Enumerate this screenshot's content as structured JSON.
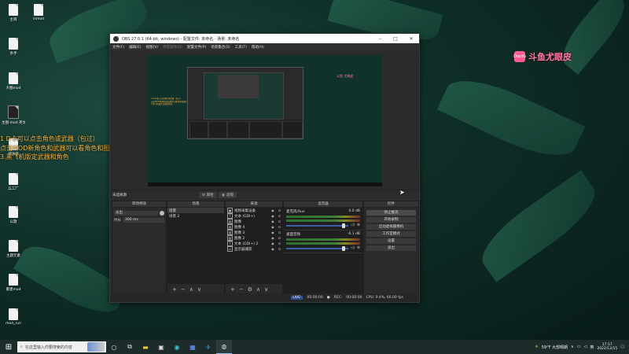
{
  "desktop_icons": [
    {
      "label": "主目",
      "dark": false
    },
    {
      "label": "inmod",
      "dark": false
    },
    {
      "label": "杀手",
      "dark": false
    },
    {
      "label": "大图mod",
      "dark": false
    },
    {
      "label": "主图-mod 英文",
      "dark": true
    },
    {
      "label": "播放器",
      "dark": false
    },
    {
      "label": "兵工厂",
      "dark": false
    },
    {
      "label": "以歌",
      "dark": false
    },
    {
      "label": "主题元素",
      "dark": false
    },
    {
      "label": "重建mod",
      "dark": false
    },
    {
      "label": "mod_run",
      "dark": false
    }
  ],
  "overlay_lines": [
    "1 D卡可以点击角色或武器（包过）",
    "点击MOD新角色和武器可以看角色和图片",
    "3.黑飞机版定武器和角色"
  ],
  "watermark": {
    "logo": "DouYu",
    "text": "斗鱼尤眼皮",
    "small": "斗鱼 尤眼皮"
  },
  "obs": {
    "title": "OBS 27.0.1 (64-bit, windows) - 配置文件: 未命名 - 场景: 未命名",
    "menu": [
      "文件(F)",
      "编辑(E)",
      "视图(V)",
      "停靠部件(D)",
      "配置文件(P)",
      "场景集合(S)",
      "工具(T)",
      "帮助(H)"
    ],
    "menu_dim": [
      false,
      false,
      false,
      true,
      false,
      false,
      false,
      false
    ],
    "no_source": "未选择源",
    "props_btn": "属性",
    "filters_btn": "滤镜",
    "docks": {
      "scene_transitions": "转场特效",
      "scenes": "场景",
      "sources": "来源",
      "mixer": "混音器",
      "controls": "控件"
    },
    "transition": {
      "name": "淡出",
      "duration_label": "时长",
      "duration": "300 ms"
    },
    "scenes": [
      "场景",
      "场景 2"
    ],
    "sources": [
      {
        "icon": "▣",
        "name": "视频采集设备"
      },
      {
        "icon": "T",
        "name": "文本 (GDI+)"
      },
      {
        "icon": "▨",
        "name": "图像"
      },
      {
        "icon": "▨",
        "name": "图像 4"
      },
      {
        "icon": "▨",
        "name": "图像 3"
      },
      {
        "icon": "▨",
        "name": "图像 2"
      },
      {
        "icon": "T",
        "name": "文本 (GDI+) 2"
      },
      {
        "icon": "▭",
        "name": "显示器捕获"
      }
    ],
    "mixer": [
      {
        "name": "麦克风/Aux",
        "db": "0.0 dB"
      },
      {
        "name": "桌面音频",
        "db": "-6.1 dB"
      }
    ],
    "controls": [
      "停止推流",
      "开始录制",
      "启动虚拟摄像机",
      "工作室模式",
      "设置",
      "退出"
    ],
    "status": {
      "live_label": "LIVE:",
      "live_time": "00:00:00",
      "rec_label": "REC:",
      "rec_time": "00:00:00",
      "cpu": "CPU: 0.4%, 60.00 fps"
    }
  },
  "taskbar": {
    "search_placeholder": "在这里输入你要搜索的内容",
    "weather": "59°F 大部晴朗",
    "time": "17:17",
    "date": "2022/12/15"
  }
}
